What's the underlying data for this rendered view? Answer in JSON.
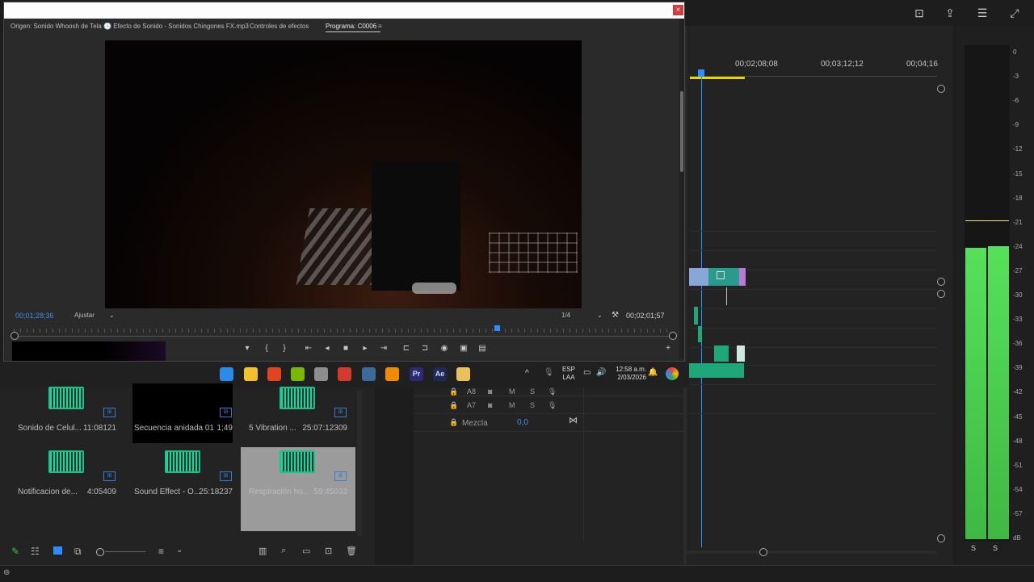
{
  "program_window": {
    "tabs": [
      "Origen: Sonido  Whoosh de Tela 🕒 Efecto de Sonido - Sonidos Chingones FX.mp3",
      "Controles de efectos",
      "Programa: C0006"
    ],
    "menu_icon": "≡",
    "close_label": "×",
    "current_timecode": "00;01;28;36",
    "fit_dropdown": "Ajustar",
    "resolution_dropdown": "1/4",
    "duration_timecode": "00;02;01;57",
    "wrench_icon": "wrench-icon",
    "playhead_fraction": 0.733
  },
  "controls": [
    {
      "name": "marker-button",
      "glyph": "▾"
    },
    {
      "name": "mark-in-button",
      "glyph": "{"
    },
    {
      "name": "mark-out-button",
      "glyph": "}"
    },
    {
      "name": "go-to-in-button",
      "glyph": "⇤"
    },
    {
      "name": "step-back-button",
      "glyph": "◂"
    },
    {
      "name": "stop-button",
      "glyph": "■"
    },
    {
      "name": "step-forward-button",
      "glyph": "▸"
    },
    {
      "name": "go-to-out-button",
      "glyph": "⇥"
    },
    {
      "name": "insert-button",
      "glyph": "⊏"
    },
    {
      "name": "overwrite-button",
      "glyph": "⊐"
    },
    {
      "name": "export-frame-button",
      "glyph": "◉"
    },
    {
      "name": "compare-button",
      "glyph": "▣"
    },
    {
      "name": "vr-button",
      "glyph": "▤"
    },
    {
      "name": "add-button",
      "glyph": "+"
    }
  ],
  "taskbar": {
    "language": "ESP",
    "layout": "LAA",
    "time": "12:58 a.m.",
    "date": "2/03/2026",
    "chevron": "^",
    "apps": [
      {
        "name": "windows-start-icon",
        "color": "#2a8bea"
      },
      {
        "name": "file-explorer-icon",
        "color": "#f2c12e"
      },
      {
        "name": "brave-icon",
        "color": "#e0451f"
      },
      {
        "name": "nvidia-icon",
        "color": "#76b900"
      },
      {
        "name": "settings-icon",
        "color": "#8d8d8d"
      },
      {
        "name": "chrome-icon",
        "color": "#d33a2c"
      },
      {
        "name": "steam-icon",
        "color": "#3b6a9b"
      },
      {
        "name": "vlc-icon",
        "color": "#f08a00"
      },
      {
        "name": "premiere-icon",
        "color": "#2b2b6f",
        "label": "Pr"
      },
      {
        "name": "after-effects-icon",
        "color": "#1e2a55",
        "label": "Ae"
      },
      {
        "name": "folder-yellow-icon",
        "color": "#e8c15a"
      }
    ]
  },
  "project_panel": {
    "items": [
      {
        "name": "Sonido de Celul...",
        "duration": "11:08121",
        "kind": "audio"
      },
      {
        "name": "Secuencia anidada 01",
        "duration": "1;49",
        "kind": "sequence"
      },
      {
        "name": "5 Vibration ...",
        "duration": "25:07:12309",
        "kind": "audio"
      },
      {
        "name": "Notificacion de...",
        "duration": "4:05409",
        "kind": "audio"
      },
      {
        "name": "Sound Effect - O...",
        "duration": "25:18237",
        "kind": "audio"
      },
      {
        "name": "Respiración ho...",
        "duration": "59:45033",
        "kind": "audio",
        "selected": true
      }
    ],
    "bottom_tools": [
      "pencil-icon",
      "list-view-icon",
      "icon-view-icon",
      "freeform-view-icon",
      "zoom-slider",
      "sort-icon",
      "chevron-down-icon",
      "automate-icon",
      "search-icon",
      "new-bin-icon",
      "new-item-icon",
      "trash-icon"
    ]
  },
  "track_panel": {
    "rows": [
      {
        "label": "A8",
        "lock": "🔒",
        "m": "M",
        "s": "S"
      },
      {
        "label": "A7",
        "lock": "🔒",
        "m": "M",
        "s": "S"
      }
    ],
    "mix_label": "Mezcla",
    "mix_value": "0,0"
  },
  "timeline": {
    "ruler": [
      "00;02;08;08",
      "00;03;12;12",
      "00;04;16"
    ],
    "playhead_color": "#2d8cff"
  },
  "meter": {
    "scale": [
      "0",
      "-3",
      "-6",
      "-9",
      "-12",
      "-15",
      "-18",
      "-21",
      "-24",
      "-27",
      "-30",
      "-33",
      "-36",
      "-39",
      "-42",
      "-45",
      "-48",
      "-51",
      "-54",
      "-57",
      "dB"
    ],
    "solo_labels": [
      "S",
      "S"
    ],
    "level_left_db": -24.2,
    "level_right_db": -24.0,
    "peak_hold_db": -20.8
  }
}
